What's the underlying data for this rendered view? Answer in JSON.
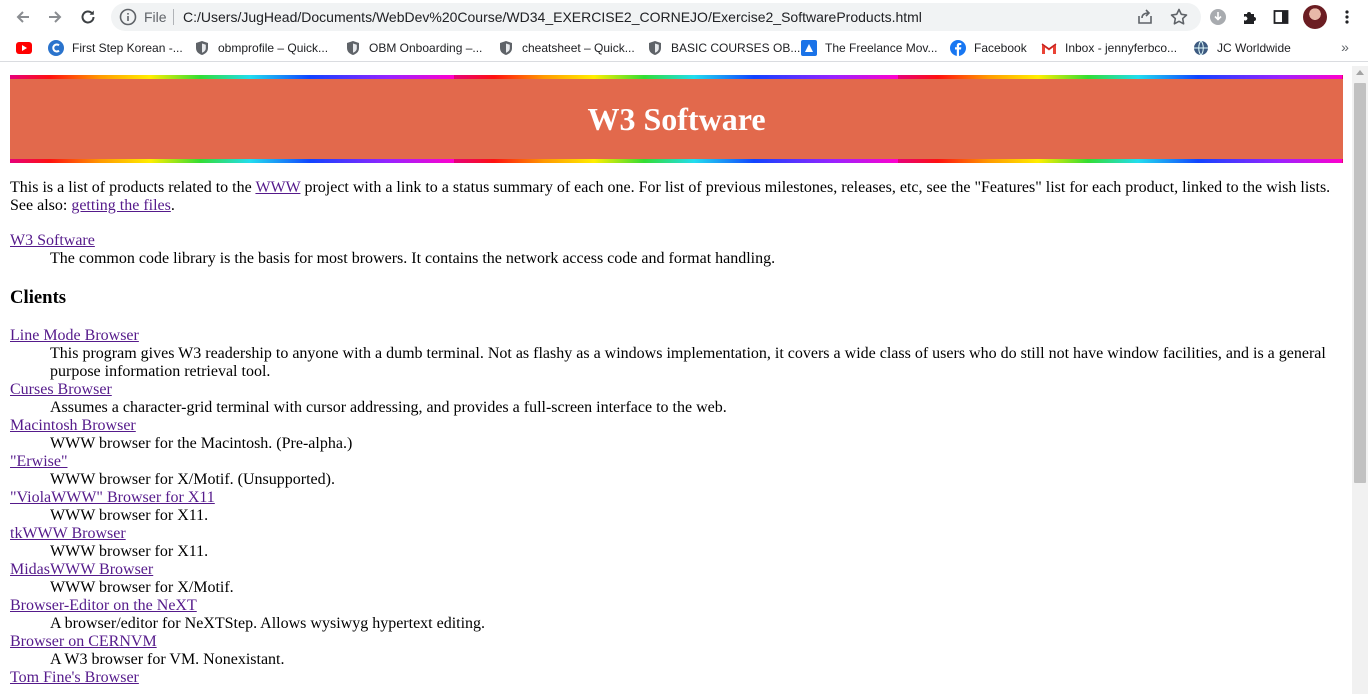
{
  "browser": {
    "address_scheme": "File",
    "address_url": "C:/Users/JugHead/Documents/WebDev%20Course/WD34_EXERCISE2_CORNEJO/Exercise2_SoftwareProducts.html",
    "icons": {
      "back": "back-arrow-icon",
      "forward": "forward-arrow-icon",
      "reload": "reload-icon",
      "info": "info-icon",
      "share": "share-icon",
      "bookmark_star": "star-icon",
      "download": "download-icon",
      "extensions": "puzzle-icon",
      "side_panel": "side-panel-icon",
      "menu": "kebab-menu-icon"
    },
    "bookmarks": [
      {
        "label": "",
        "icon": "youtube-icon"
      },
      {
        "label": "First Step Korean -...",
        "icon": "coursera-icon"
      },
      {
        "label": "obmprofile – Quick...",
        "icon": "shield-icon"
      },
      {
        "label": "OBM Onboarding –...",
        "icon": "shield-icon"
      },
      {
        "label": "cheatsheet – Quick...",
        "icon": "shield-icon"
      },
      {
        "label": "BASIC COURSES OB...",
        "icon": "shield-icon"
      },
      {
        "label": "The Freelance Mov...",
        "icon": "freelance-icon"
      },
      {
        "label": "Facebook",
        "icon": "facebook-icon"
      },
      {
        "label": "Inbox - jennyferbco...",
        "icon": "gmail-icon"
      },
      {
        "label": "JC Worldwide",
        "icon": "globe-icon"
      }
    ],
    "bookmarks_overflow": "»"
  },
  "page": {
    "title": "W3 Software",
    "intro": {
      "t1": "This is a list of products related to the ",
      "link1": "WWW",
      "t2": " project with a link to a status summary of each one. For list of previous milestones, releases, etc, see the \"Features\" list for each product, linked to the wish lists. See also: ",
      "link2": "getting the files",
      "t3": "."
    },
    "library": {
      "term": "W3 Software",
      "desc": "The common code library is the basis for most browers. It contains the network access code and format handling."
    },
    "clients_heading": "Clients",
    "clients": [
      {
        "term": "Line Mode Browser",
        "desc": "This program gives W3 readership to anyone with a dumb terminal. Not as flashy as a windows implementation, it covers a wide class of users who do still not have window facilities, and is a general purpose information retrieval tool."
      },
      {
        "term": "Curses Browser",
        "desc": "Assumes a character-grid terminal with cursor addressing, and provides a full-screen interface to the web."
      },
      {
        "term": "Macintosh Browser",
        "desc": "WWW browser for the Macintosh. (Pre-alpha.)"
      },
      {
        "term": "\"Erwise\"",
        "desc": "WWW browser for X/Motif. (Unsupported)."
      },
      {
        "term": "\"ViolaWWW\" Browser for X11",
        "desc": "WWW browser for X11."
      },
      {
        "term": "tkWWW Browser",
        "desc": "WWW browser for X11."
      },
      {
        "term": "MidasWWW Browser",
        "desc": "WWW browser for X/Motif."
      },
      {
        "term": "Browser-Editor on the NeXT",
        "desc": "A browser/editor for NeXTStep. Allows wysiwyg hypertext editing."
      },
      {
        "term": "Browser on CERNVM",
        "desc": "A W3 browser for VM. Nonexistant."
      },
      {
        "term": "Tom Fine's Browser",
        "desc": ""
      }
    ],
    "colors": {
      "banner_bg": "#e2694c",
      "banner_text": "#ffffff",
      "link": "#551a8b"
    }
  }
}
